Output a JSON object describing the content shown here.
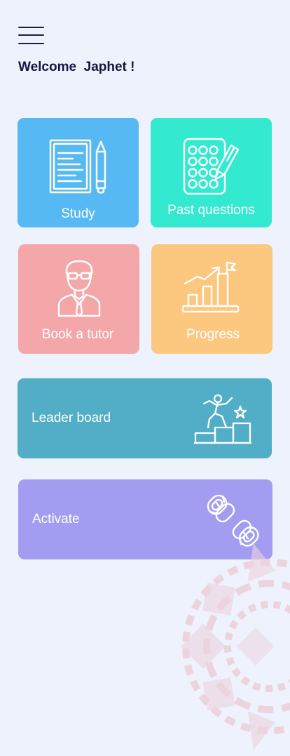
{
  "header": {
    "menu_icon": "hamburger-menu-icon",
    "welcome_text": "Welcome  Japhet !"
  },
  "tiles": {
    "study": {
      "label": "Study",
      "color": "#56b9f3",
      "icon": "document-pencil-icon"
    },
    "past_questions": {
      "label": "Past questions",
      "color": "#33ead1",
      "icon": "answer-sheet-pen-icon"
    },
    "book_tutor": {
      "label": "Book a tutor",
      "color": "#f4a7a9",
      "icon": "tutor-person-icon"
    },
    "progress": {
      "label": "Progress",
      "color": "#fcc77f",
      "icon": "growth-chart-flag-icon"
    },
    "leader_board": {
      "label": "Leader board",
      "color": "#51aec6",
      "icon": "podium-climber-icon"
    },
    "activate": {
      "label": "Activate",
      "color": "#a39df2",
      "icon": "broken-chain-icon"
    }
  }
}
